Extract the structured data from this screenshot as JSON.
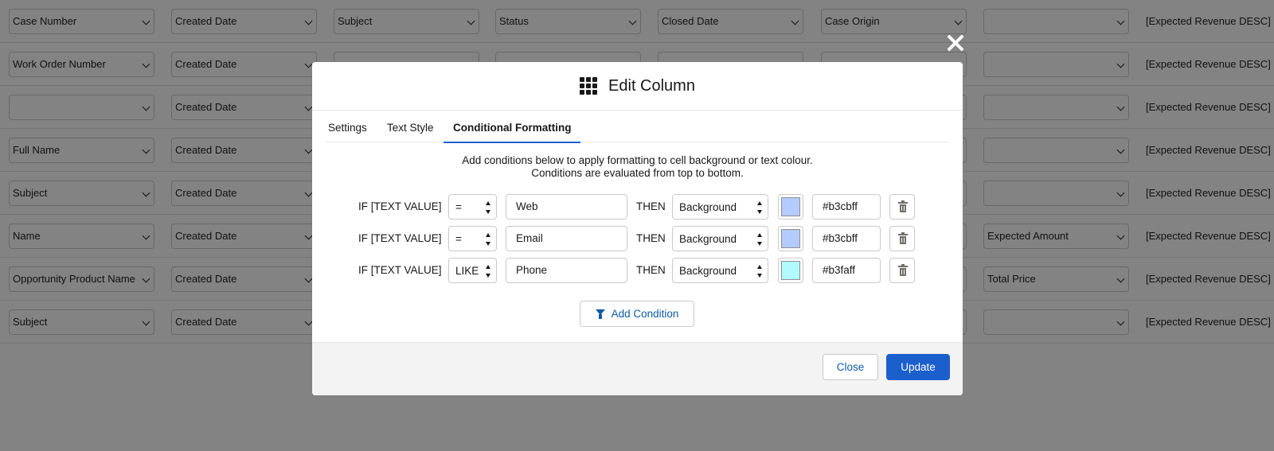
{
  "background": {
    "rows": [
      {
        "c1": "Case Number",
        "c2": "Created Date",
        "c3": "Subject",
        "c4": "Status",
        "c5": "Closed Date",
        "c6": "Case Origin",
        "c7": "",
        "sort": "[Expected Revenue DESC]"
      },
      {
        "c1": "Work Order Number",
        "c2": "Created Date",
        "c3": "",
        "c4": "",
        "c5": "",
        "c6": "",
        "c7": "",
        "sort": "[Expected Revenue DESC]"
      },
      {
        "c1": "",
        "c2": "Created Date",
        "c3": "",
        "c4": "",
        "c5": "",
        "c6": "",
        "c7": "",
        "sort": "[Expected Revenue DESC]"
      },
      {
        "c1": "Full Name",
        "c2": "Created Date",
        "c3": "",
        "c4": "",
        "c5": "",
        "c6": "",
        "c7": "",
        "sort": "[Expected Revenue DESC]"
      },
      {
        "c1": "Subject",
        "c2": "Created Date",
        "c3": "",
        "c4": "",
        "c5": "",
        "c6": "",
        "c7": "",
        "sort": "[Expected Revenue DESC]"
      },
      {
        "c1": "Name",
        "c2": "Created Date",
        "c3": "",
        "c4": "",
        "c5": "",
        "c6": "",
        "c7": "Expected Amount",
        "sort": "[Expected Revenue DESC]"
      },
      {
        "c1": "Opportunity Product Name",
        "c2": "Created Date",
        "c3": "",
        "c4": "",
        "c5": "",
        "c6": "",
        "c7": "Total Price",
        "sort": "[Expected Revenue DESC]"
      },
      {
        "c1": "Subject",
        "c2": "Created Date",
        "c3": "",
        "c4": "",
        "c5": "",
        "c6": "",
        "c7": "",
        "sort": "[Expected Revenue DESC]"
      }
    ]
  },
  "modal": {
    "title": "Edit Column",
    "title_icon": "app-grid-icon",
    "close_icon": "close-icon",
    "tabs": [
      {
        "label": "Settings",
        "active": false
      },
      {
        "label": "Text Style",
        "active": false
      },
      {
        "label": "Conditional Formatting",
        "active": true
      }
    ],
    "instructions_line1": "Add conditions below to apply formatting to cell background or text colour.",
    "instructions_line2": "Conditions are evaluated from top to bottom.",
    "conditions": [
      {
        "if_label": "IF [TEXT VALUE]",
        "operator": "=",
        "value": "Web",
        "then_label": "THEN",
        "target": "Background",
        "color": "#b3cbff",
        "hex": "#b3cbff"
      },
      {
        "if_label": "IF [TEXT VALUE]",
        "operator": "=",
        "value": "Email",
        "then_label": "THEN",
        "target": "Background",
        "color": "#b3cbff",
        "hex": "#b3cbff"
      },
      {
        "if_label": "IF [TEXT VALUE]",
        "operator": "LIKE",
        "value": "Phone",
        "then_label": "THEN",
        "target": "Background",
        "color": "#b3faff",
        "hex": "#b3faff"
      }
    ],
    "add_condition_label": "Add Condition",
    "footer": {
      "close_label": "Close",
      "update_label": "Update"
    }
  },
  "colors": {
    "brand": "#1b5fcc",
    "link": "#0b5cab",
    "backdrop": "rgba(8,7,7,0.5)"
  }
}
